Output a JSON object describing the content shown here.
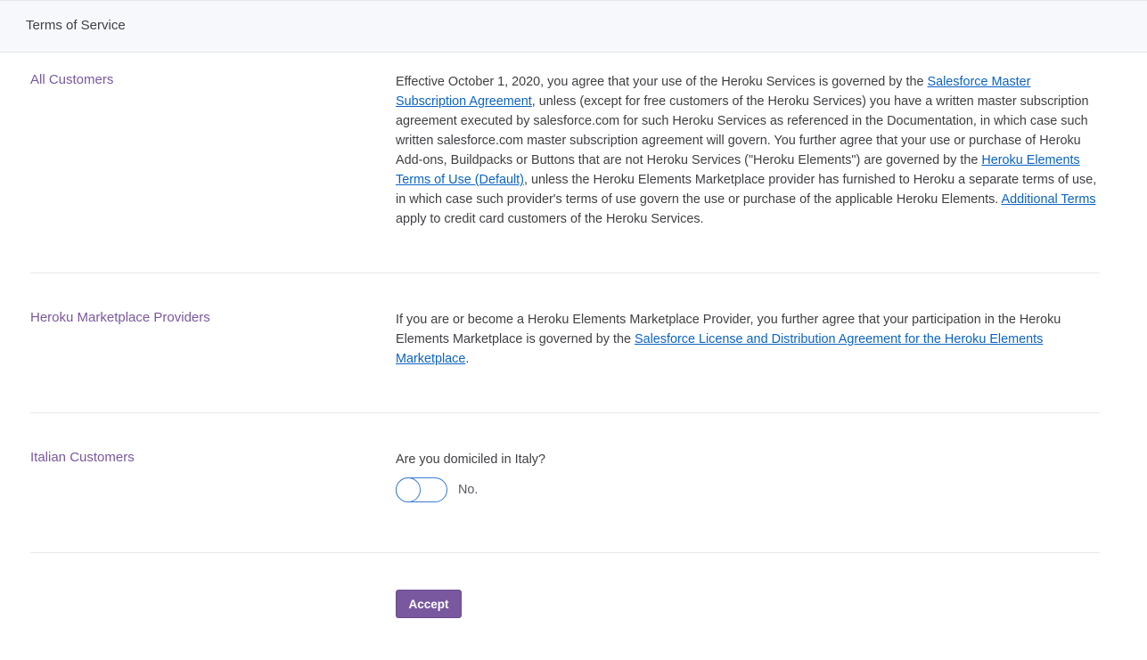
{
  "header": {
    "title": "Terms of Service"
  },
  "sections": {
    "all_customers": {
      "label": "All Customers",
      "text_1": "Effective October 1, 2020, you agree that your use of the Heroku Services is governed by the ",
      "link_1": "Salesforce Master Subscription Agreement",
      "text_2": ", unless (except for free customers of the Heroku Services) you have a written master subscription agreement executed by salesforce.com for such Heroku Services as referenced in the Documentation, in which case such written salesforce.com master subscription agreement will govern. You further agree that your use or purchase of Heroku Add-ons, Buildpacks or Buttons that are not Heroku Services (\"Heroku Elements\") are governed by the ",
      "link_2": "Heroku Elements Terms of Use (Default)",
      "text_3": ", unless the Heroku Elements Marketplace provider has furnished to Heroku a separate terms of use, in which case such provider's terms of use govern the use or purchase of the applicable Heroku Elements. ",
      "link_3": "Additional Terms",
      "text_4": " apply to credit card customers of the Heroku Services."
    },
    "marketplace_providers": {
      "label": "Heroku Marketplace Providers",
      "text_1": "If you are or become a Heroku Elements Marketplace Provider, you further agree that your participation in the Heroku Elements Marketplace is governed by the ",
      "link_1": "Salesforce License and Distribution Agreement for the Heroku Elements Marketplace",
      "text_2": "."
    },
    "italian_customers": {
      "label": "Italian Customers",
      "question": "Are you domiciled in Italy?",
      "toggle_label": "No."
    }
  },
  "actions": {
    "accept_label": "Accept"
  },
  "colors": {
    "accent": "#79589f",
    "link": "#0b63c4",
    "toggle_border": "#3a7bd5"
  }
}
